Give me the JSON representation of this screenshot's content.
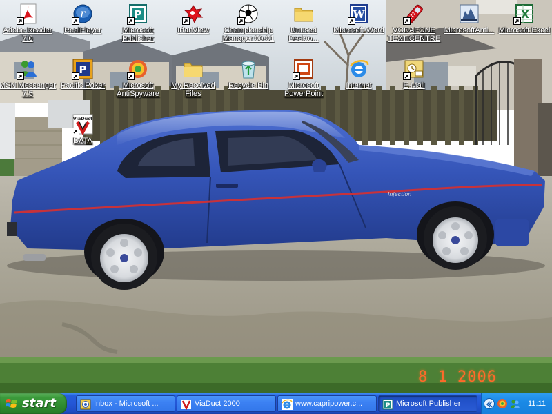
{
  "desktop": {
    "icons": [
      {
        "id": "adobe-reader",
        "label": "Adobe Reader\n7.0",
        "icon": "adobe-reader-icon"
      },
      {
        "id": "realplayer",
        "label": "RealPlayer",
        "icon": "realplayer-icon"
      },
      {
        "id": "ms-publisher",
        "label": "Microsoft\nPublisher",
        "icon": "publisher-icon"
      },
      {
        "id": "irfanview",
        "label": "IrfanView",
        "icon": "irfanview-icon"
      },
      {
        "id": "championship-manager",
        "label": "Championship\nManager 00-01",
        "icon": "football-icon"
      },
      {
        "id": "unused-desktop",
        "label": "Unused\nDeskto...",
        "icon": "folder-icon"
      },
      {
        "id": "ms-word",
        "label": "Microsoft Word",
        "icon": "word-icon"
      },
      {
        "id": "vodafone",
        "label": "VODAFONE\nTEXT CENTRE",
        "icon": "phone-icon"
      },
      {
        "id": "ms-antispyware-top",
        "label": "MicrosoftAnti...",
        "icon": "antispyware-castle-icon"
      },
      {
        "id": "ms-excel",
        "label": "Microsoft Excel",
        "icon": "excel-icon"
      },
      {
        "id": "msn-messenger",
        "label": "MSN Messenger\n7.5",
        "icon": "msn-messenger-icon"
      },
      {
        "id": "pacific-poker",
        "label": "Pacific Poker",
        "icon": "poker-icon"
      },
      {
        "id": "ms-antispyware",
        "label": "Microsoft\nAntiSpyware",
        "icon": "antispyware-icon"
      },
      {
        "id": "my-received-files",
        "label": "My Received\nFiles",
        "icon": "folder-icon"
      },
      {
        "id": "recycle-bin",
        "label": "Recycle Bin",
        "icon": "recycle-bin-icon"
      },
      {
        "id": "ms-powerpoint",
        "label": "Microsoft\nPowerPoint",
        "icon": "powerpoint-icon"
      },
      {
        "id": "internet",
        "label": "Internet",
        "icon": "internet-explorer-icon"
      },
      {
        "id": "email",
        "label": "E-Mail",
        "icon": "email-icon"
      },
      {
        "id": "data",
        "label": "DATA",
        "icon": "viaduct-icon"
      }
    ],
    "photo_date": "8  1 2006"
  },
  "taskbar": {
    "start_label": "start",
    "tasks": [
      {
        "label": "Inbox - Microsoft ...",
        "icon": "outlook-icon",
        "active": false
      },
      {
        "label": "ViaDuct 2000",
        "icon": "viaduct-icon",
        "active": false
      },
      {
        "label": "www.capripower.c...",
        "icon": "internet-explorer-icon",
        "active": false
      },
      {
        "label": "Microsoft Publisher",
        "icon": "publisher-icon",
        "active": true
      }
    ],
    "clock": "11:11"
  },
  "colors": {
    "taskbar_blue": "#245edb",
    "start_green": "#3c9b3c",
    "tray_blue": "#1b8ae6",
    "car_blue": "#2f4fb0",
    "date_stamp": "#ff6a2a"
  }
}
